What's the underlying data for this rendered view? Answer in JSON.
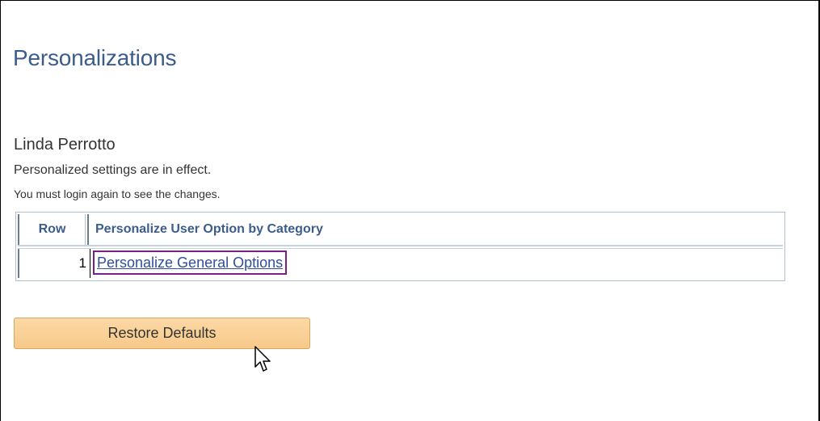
{
  "page": {
    "title": "Personalizations"
  },
  "user": {
    "name": "Linda Perrotto",
    "status_message": "Personalized settings are in effect.",
    "login_message": "You must login again to see the changes."
  },
  "grid": {
    "columns": [
      "Row",
      "Personalize User Option by Category"
    ],
    "rows": [
      {
        "row": "1",
        "category": "Personalize General Options"
      }
    ]
  },
  "actions": {
    "restore_defaults_label": "Restore Defaults"
  },
  "colors": {
    "title": "#3c5c8c",
    "link": "#2f4ea0",
    "focus_outline": "#7a1f86",
    "button_fill": "#f7c98a"
  },
  "icons": {
    "cursor": "mouse-pointer-icon"
  }
}
